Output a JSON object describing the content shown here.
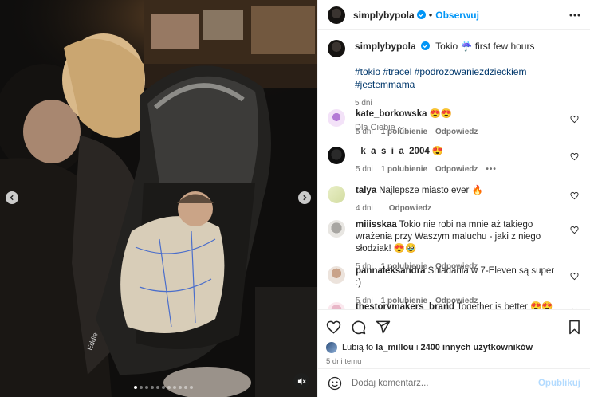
{
  "post": {
    "username": "simplybypola",
    "follow_label": "Obserwuj",
    "caption_text": "Tokio ☔ first few hours",
    "hashtags": "#tokio #tracel #podrozowaniezdzieckiem #jestemmama",
    "caption_age": "5 dni"
  },
  "media": {
    "slide_count": 11,
    "active_slide": 0
  },
  "comments_sort_label": "Dla Ciebie",
  "comments": [
    {
      "user": "kate_borkowska",
      "text": "😍😍",
      "age": "5 dni",
      "replies": "1 polubienie",
      "reply_label": "Odpowiedz",
      "more": false
    },
    {
      "user": "_k_a_s_i_a_2004",
      "text": "😍",
      "age": "5 dni",
      "replies": "1 polubienie",
      "reply_label": "Odpowiedz",
      "more": true
    },
    {
      "user": "talya",
      "text": "Najlepsze miasto ever 🔥",
      "age": "4 dni",
      "replies": "",
      "reply_label": "Odpowiedz",
      "more": false
    },
    {
      "user": "miiisskaa",
      "text": "Tokio nie robi na mnie aż takiego wrażenia przy Waszym maluchu - jaki z niego słodziak! 😍🥹",
      "age": "5 dni",
      "replies": "1 polubienie",
      "reply_label": "Odpowiedz",
      "more": false
    },
    {
      "user": "pannaleksandra",
      "text": "Śniadania w 7-Eleven są super :)",
      "age": "5 dni",
      "replies": "1 polubienie",
      "reply_label": "Odpowiedz",
      "more": false
    },
    {
      "user": "thestorymakers_brand",
      "text": "Together is better 😍😍✨",
      "age": "",
      "replies": "",
      "reply_label": "",
      "more": false
    }
  ],
  "likes": {
    "prefix": "Lubią to ",
    "user": "la_millou",
    "middle": " i ",
    "count": "2400 innych użytkowników"
  },
  "posted_ago": "5 dni temu",
  "comment_box": {
    "placeholder": "Dodaj komentarz...",
    "post_label": "Opublikuj"
  },
  "colors": {
    "accent": "#0095f6",
    "link": "#00376b",
    "muted": "#737373",
    "disabled_post": "#b3dbff"
  },
  "icons": [
    "verified-icon",
    "more-options-icon",
    "chevron-down-icon",
    "heart-icon",
    "comment-icon",
    "share-icon",
    "bookmark-icon",
    "emoji-icon",
    "chevron-left-icon",
    "chevron-right-icon",
    "mute-icon"
  ]
}
